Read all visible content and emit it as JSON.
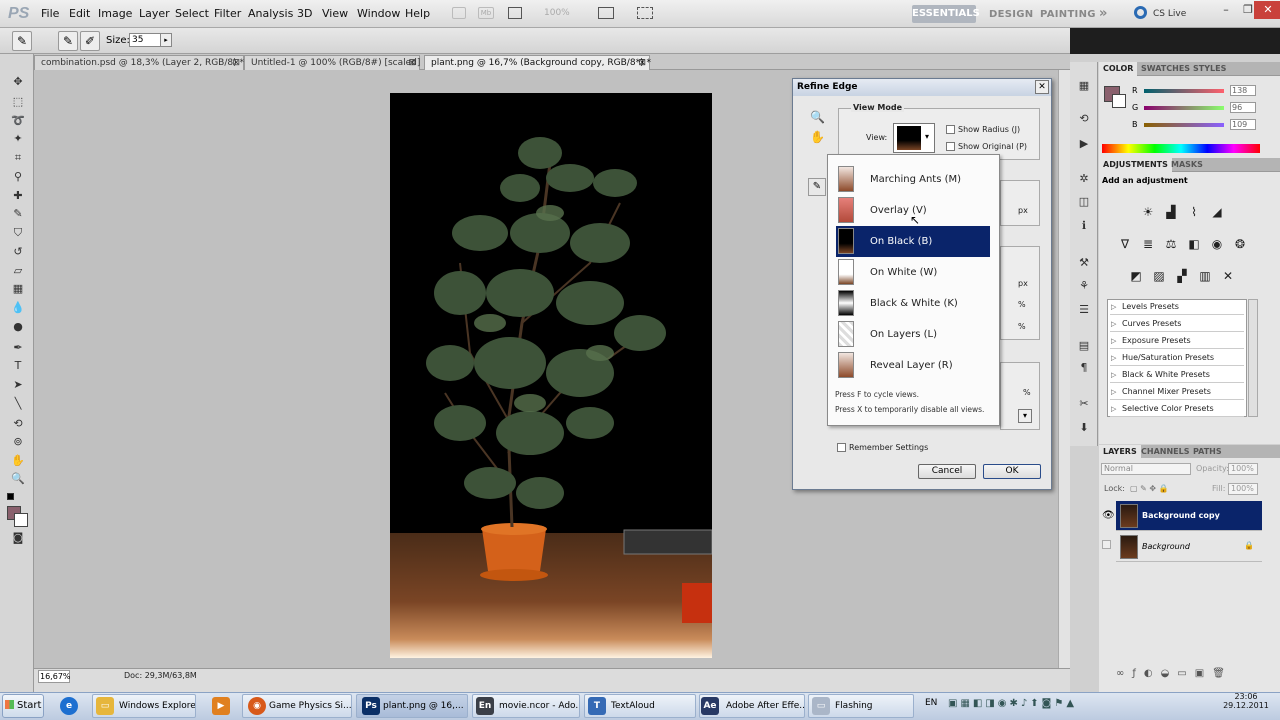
{
  "menubar": {
    "logo": "PS",
    "items": [
      "File",
      "Edit",
      "Image",
      "Layer",
      "Select",
      "Filter",
      "Analysis",
      "3D",
      "View",
      "Window",
      "Help"
    ],
    "zoom_level": "100%",
    "workspaces": [
      "ESSENTIALS",
      "DESIGN",
      "PAINTING"
    ],
    "more": "»",
    "cs_live": "CS Live"
  },
  "options_bar": {
    "size_label": "Size:",
    "size_value": "35"
  },
  "tabs": [
    {
      "label": "combination.psd @ 18,3% (Layer 2, RGB/8) *"
    },
    {
      "label": "Untitled-1 @ 100% (RGB/8#) [scaled]"
    },
    {
      "label": "plant.png @ 16,7% (Background copy, RGB/8*) *"
    }
  ],
  "status": {
    "zoom": "16,67%",
    "doc": "Doc: 29,3M/63,8M"
  },
  "color_panel": {
    "tabs": [
      "COLOR",
      "SWATCHES",
      "STYLES"
    ],
    "rows": [
      {
        "label": "R",
        "value": "138"
      },
      {
        "label": "G",
        "value": "96"
      },
      {
        "label": "B",
        "value": "109"
      }
    ],
    "foreground": "#8a606d"
  },
  "adjustments_panel": {
    "tabs": [
      "ADJUSTMENTS",
      "MASKS"
    ],
    "heading": "Add an adjustment",
    "presets": [
      "Levels Presets",
      "Curves Presets",
      "Exposure Presets",
      "Hue/Saturation Presets",
      "Black & White Presets",
      "Channel Mixer Presets",
      "Selective Color Presets"
    ]
  },
  "layers_panel": {
    "tabs": [
      "LAYERS",
      "CHANNELS",
      "PATHS"
    ],
    "blend_mode": "Normal",
    "opacity_label": "Opacity:",
    "opacity_value": "100%",
    "lock_label": "Lock:",
    "fill_label": "Fill:",
    "fill_value": "100%",
    "layers": [
      {
        "name": "Background copy",
        "selected": true
      },
      {
        "name": "Background",
        "selected": false
      }
    ]
  },
  "refine_edge": {
    "title": "Refine Edge",
    "view_mode_label": "View Mode",
    "view_label": "View:",
    "show_radius": "Show Radius (J)",
    "show_original": "Show Original (P)",
    "px1": "px",
    "px2": "px",
    "pct1": "%",
    "pct2": "%",
    "pct3": "%",
    "remember": "Remember Settings",
    "cancel": "Cancel",
    "ok": "OK",
    "view_options": [
      {
        "label": "Marching Ants (M)",
        "selected": false
      },
      {
        "label": "Overlay (V)",
        "selected": false
      },
      {
        "label": "On Black (B)",
        "selected": true
      },
      {
        "label": "On White (W)",
        "selected": false
      },
      {
        "label": "Black & White (K)",
        "selected": false
      },
      {
        "label": "On Layers (L)",
        "selected": false
      },
      {
        "label": "Reveal Layer (R)",
        "selected": false
      }
    ],
    "note1": "Press F to cycle views.",
    "note2": "Press X to temporarily disable all views."
  },
  "taskbar": {
    "start": "Start",
    "tasks": [
      {
        "label": "Windows Explorer"
      },
      {
        "label": "Game Physics Si..."
      },
      {
        "label": "plant.png @ 16,..."
      },
      {
        "label": "movie.ncor - Ado..."
      },
      {
        "label": "TextAloud"
      },
      {
        "label": "Adobe After Effe..."
      },
      {
        "label": "Flashing"
      }
    ],
    "lang": "EN",
    "time": "23:06",
    "date": "29.12.2011"
  }
}
